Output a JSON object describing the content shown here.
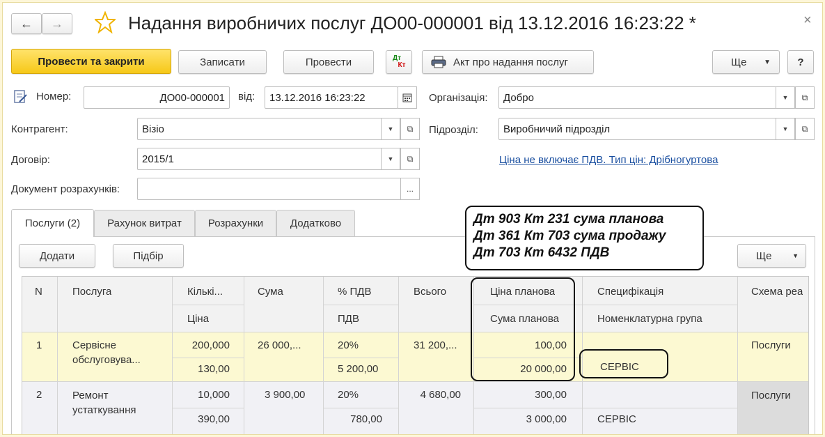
{
  "window": {
    "title": "Надання виробничих послуг ДО00-000001 від 13.12.2016 16:23:22 *",
    "close": "×"
  },
  "nav": {
    "back": "←",
    "forward": "→",
    "star": "☆"
  },
  "toolbar": {
    "post_close": "Провести та закрити",
    "save": "Записати",
    "post": "Провести",
    "dt": "Дт",
    "kt": "Кт",
    "act": "Акт про надання послуг",
    "more": "Ще",
    "help": "?"
  },
  "form": {
    "number_label": "Номер:",
    "number_value": "ДО00-000001",
    "date_label": "від:",
    "date_value": "13.12.2016 16:23:22",
    "org_label": "Організація:",
    "org_value": "Добро",
    "counterparty_label": "Контрагент:",
    "counterparty_value": "Візіо",
    "division_label": "Підрозділ:",
    "division_value": "Виробничий підрозділ",
    "contract_label": "Договір:",
    "contract_value": "2015/1",
    "price_link": "Ціна не включає ПДВ. Тип цін: Дрібногуртова",
    "settle_label": "Документ розрахунків:",
    "settle_value": "",
    "ellipsis": "..."
  },
  "tabs": [
    {
      "label": "Послуги (2)"
    },
    {
      "label": "Рахунок витрат"
    },
    {
      "label": "Розрахунки"
    },
    {
      "label": "Додатково"
    }
  ],
  "table_toolbar": {
    "add": "Додати",
    "pick": "Підбір",
    "more": "Ще"
  },
  "note": [
    "Дт 903  Кт 231  сума планова",
    "Дт 361  Кт 703  сума продажу",
    "Дт 703  Кт 6432  ПДВ"
  ],
  "table": {
    "headers": {
      "n": "N",
      "service": "Послуга",
      "qty": "Кількі...",
      "price": "Ціна",
      "sum": "Сума",
      "vat_rate": "% ПДВ",
      "vat": "ПДВ",
      "total": "Всього",
      "plan_price": "Ціна планова",
      "plan_sum": "Сума планова",
      "spec": "Специфікація",
      "nom_group": "Номенклатурна група",
      "scheme": "Схема реа"
    },
    "rows": [
      {
        "n": "1",
        "service_line1": "Сервісне",
        "service_line2": "обслуговува...",
        "qty": "200,000",
        "price": "130,00",
        "sum": "26 000,...",
        "vat_rate": "20%",
        "vat": "5 200,00",
        "total": "31 200,...",
        "plan_price": "100,00",
        "plan_sum": "20 000,00",
        "spec": "",
        "nom_group": "СЕРВІС",
        "scheme": "Послуги"
      },
      {
        "n": "2",
        "service_line1": "Ремонт",
        "service_line2": "устаткування",
        "qty": "10,000",
        "price": "390,00",
        "sum": "3 900,00",
        "vat_rate": "20%",
        "vat": "780,00",
        "total": "4 680,00",
        "plan_price": "300,00",
        "plan_sum": "3 000,00",
        "spec": "",
        "nom_group": "СЕРВІС",
        "scheme": "Послуги"
      }
    ]
  }
}
